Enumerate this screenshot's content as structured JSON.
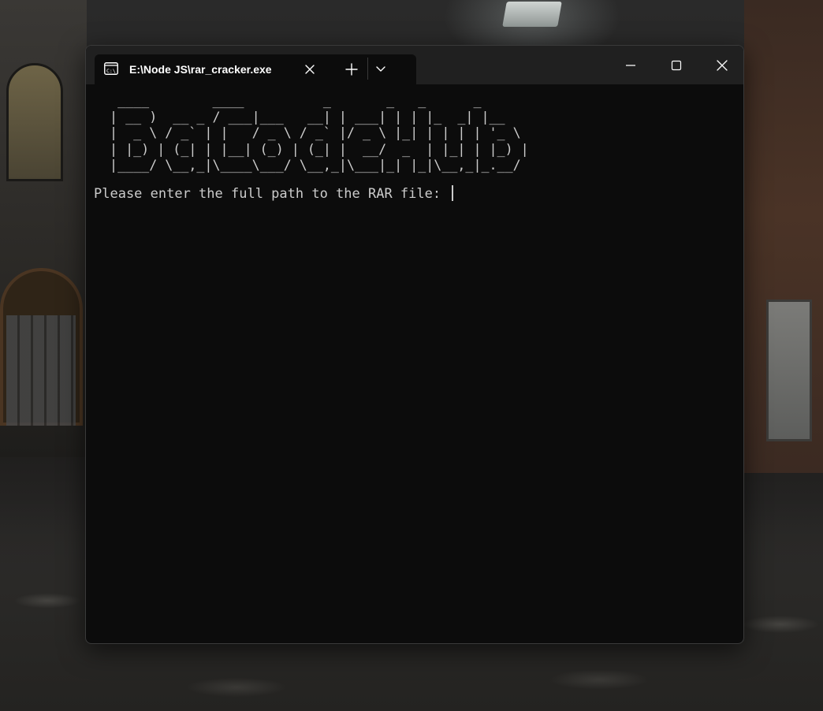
{
  "window": {
    "tab_title": "E:\\Node JS\\rar_cracker.exe",
    "tab_icon": "terminal-icon",
    "controls": {
      "minimize_icon": "minimize-icon",
      "maximize_icon": "maximize-icon",
      "close_icon": "close-icon"
    }
  },
  "console": {
    "banner": "   ____        ____          _       _   _      _\n  | __ )  __ _ / ___|___   __| | ___| | | |_  _| |__\n  |  _ \\ / _` | |   / _ \\ / _` |/ _ \\ |_| | | | | '_ \\\n  | |_) | (_| | |__| (_) | (_| |  __/  _  | |_| | |_) |\n  |____/ \\__,_|\\____\\___/ \\__,_|\\___|_| |_|\\__,_|_.__/",
    "prompt": "Please enter the full path to the RAR file: "
  },
  "colors": {
    "terminal_bg": "#0c0c0c",
    "titlebar_bg": "#202020",
    "text": "#cccccc"
  }
}
